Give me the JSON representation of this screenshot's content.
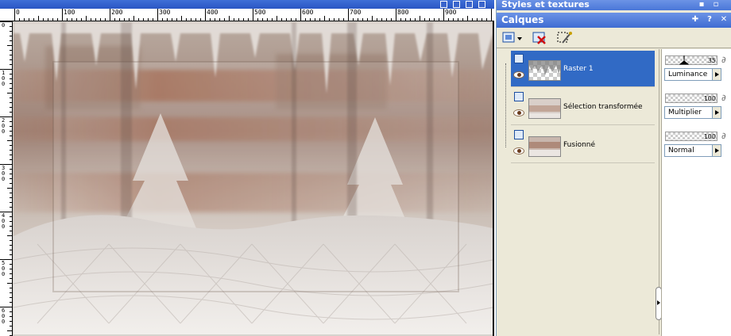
{
  "canvas": {
    "ruler_labels": [
      "0",
      "100",
      "200",
      "300",
      "400",
      "500",
      "600",
      "700",
      "800",
      "900"
    ],
    "v_ruler_labels": [
      "0",
      "100",
      "200",
      "300",
      "400",
      "500",
      "600"
    ]
  },
  "panels": {
    "styles_title": "Styles et textures",
    "layers_title": "Calques",
    "layers": [
      {
        "name": "Raster 1",
        "opacity": "35",
        "blend_mode": "Luminance",
        "selected": true
      },
      {
        "name": "Sélection transformée",
        "opacity": "100",
        "blend_mode": "Multiplier",
        "selected": false
      },
      {
        "name": "Fusionné",
        "opacity": "100",
        "blend_mode": "Normal",
        "selected": false
      }
    ]
  },
  "colors": {
    "title_blue": "#3f6cd2",
    "selection_blue": "#316ac5",
    "panel_bg": "#ece9d8",
    "snow": "#e8e4e0",
    "rust": "#a0705a"
  }
}
